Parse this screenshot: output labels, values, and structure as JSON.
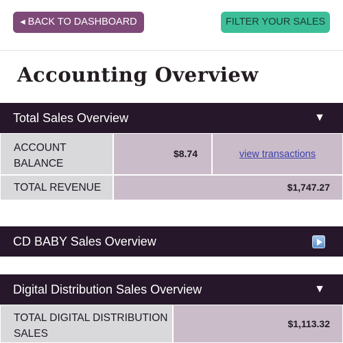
{
  "topbar": {
    "back_label": "◂ BACK TO DASHBOARD",
    "filter_label": "FILTER YOUR SALES"
  },
  "page_title": "Accounting Overview",
  "sections": {
    "total": {
      "title": "Total Sales Overview",
      "toggle": "▼",
      "rows": {
        "account_balance_label": "ACCOUNT BALANCE",
        "account_balance_value": "$8.74",
        "view_transactions": "view transactions",
        "total_revenue_label": "TOTAL REVENUE",
        "total_revenue_value": "$1,747.27"
      }
    },
    "cd_baby": {
      "title": "CD BABY Sales Overview",
      "toggle_icon": "play-icon"
    },
    "digital": {
      "title": "Digital Distribution Sales Overview",
      "toggle": "▼",
      "rows": {
        "total_dd_label": "TOTAL DIGITAL DISTRIBUTION SALES",
        "total_dd_value": "$1,113.32"
      }
    }
  },
  "colors": {
    "back_button": "#7e4a78",
    "filter_button": "#3cbf98",
    "section_header": "#26172a",
    "label_cell": "#d9d8db",
    "value_cell": "#cbbcca",
    "link": "#3b3fa8"
  }
}
